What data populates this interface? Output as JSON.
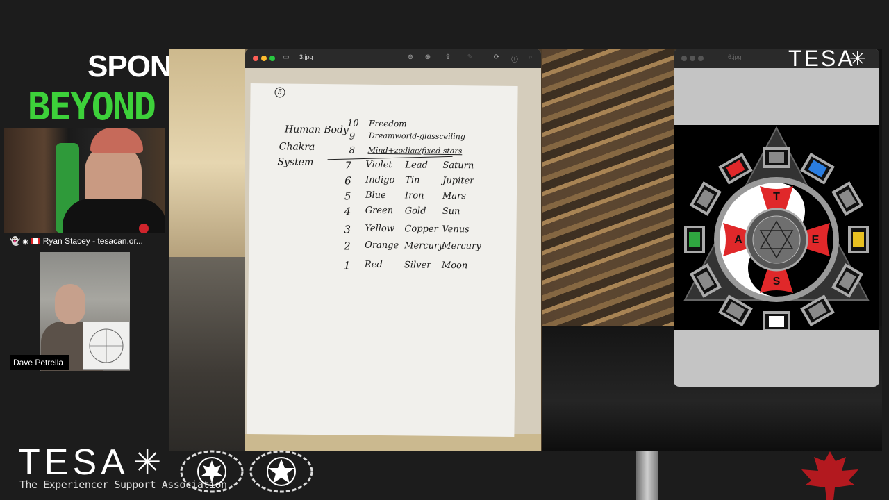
{
  "sponsor": {
    "text": "SPONS",
    "beyond": "BEYOND"
  },
  "participants": [
    {
      "name": "Ryan Stacey - tesacan.or...",
      "icons": [
        "ghost-icon",
        "eye-icon",
        "canada-flag-icon"
      ]
    },
    {
      "name": "Dave Petrella"
    }
  ],
  "window1": {
    "filename": "3.jpg",
    "toolbar_icons": [
      "sidebar-icon",
      "zoom-out-icon",
      "zoom-in-icon",
      "share-icon",
      "markup-icon",
      "rotate-icon",
      "info-icon",
      "search-icon"
    ],
    "page_marker": "5",
    "left_labels": [
      "Human Body",
      "Chakra",
      "System"
    ],
    "rows": [
      {
        "num": "10",
        "text": "Freedom"
      },
      {
        "num": "9",
        "text": "Dreamworld-glassceiling"
      },
      {
        "num": "8",
        "text": "Mind+zodiac/fixed stars"
      }
    ],
    "table": [
      {
        "num": "7",
        "color": "Violet",
        "metal": "Lead",
        "planet": "Saturn"
      },
      {
        "num": "6",
        "color": "Indigo",
        "metal": "Tin",
        "planet": "Jupiter"
      },
      {
        "num": "5",
        "color": "Blue",
        "metal": "Iron",
        "planet": "Mars"
      },
      {
        "num": "4",
        "color": "Green",
        "metal": "Gold",
        "planet": "Sun"
      },
      {
        "num": "3",
        "color": "Yellow",
        "metal": "Copper",
        "planet": "Venus"
      },
      {
        "num": "2",
        "color": "Orange",
        "metal": "Mercury",
        "planet": "Mercury"
      },
      {
        "num": "1",
        "color": "Red",
        "metal": "Silver",
        "planet": "Moon"
      }
    ]
  },
  "window2": {
    "filename": "6.jpg",
    "wheel_letters": [
      "T",
      "E",
      "S",
      "A"
    ],
    "colors": {
      "red": "#e0282a",
      "blue": "#2a7de0",
      "green": "#2fa640",
      "yellow": "#e8c020",
      "gray": "#8a8a8a"
    }
  },
  "brand": {
    "top_right": "TESA",
    "logo": "TESA",
    "tagline": "The Experiencer Support Association"
  }
}
